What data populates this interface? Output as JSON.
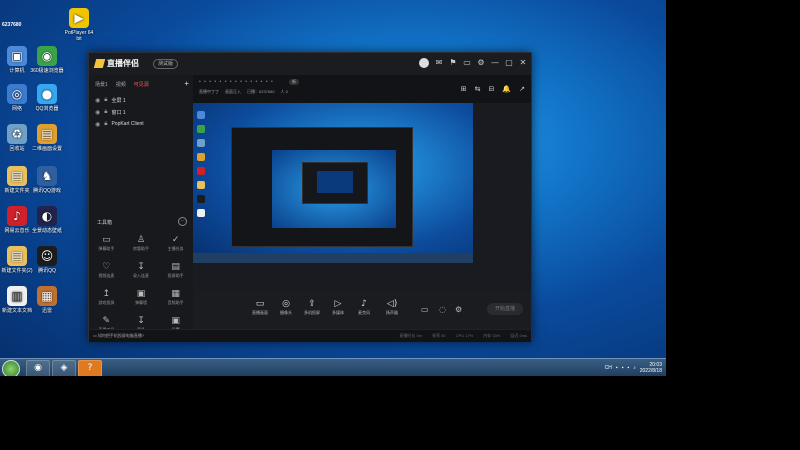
{
  "desktop": {
    "top_left_label": "6237680",
    "icons": [
      {
        "id": "potplayer",
        "label": "PotPlayer 64 bit",
        "glyph": "▶",
        "color": "#f0c400"
      },
      {
        "id": "computer",
        "label": "计算机",
        "glyph": "▣",
        "color": "#4a8ad8"
      },
      {
        "id": "browser360",
        "label": "360极速浏览器",
        "glyph": "◉",
        "color": "#3aa34a"
      },
      {
        "id": "network",
        "label": "网络",
        "glyph": "◎",
        "color": "#3b7bd0"
      },
      {
        "id": "qqbrowser",
        "label": "QQ浏览器",
        "glyph": "●",
        "color": "#37a7f0"
      },
      {
        "id": "recycle",
        "label": "回收站",
        "glyph": "♻",
        "color": "#6fa0c8"
      },
      {
        "id": "folder1",
        "label": "二维画面设置",
        "glyph": "▤",
        "color": "#e0a030"
      },
      {
        "id": "folder2",
        "label": "新建文件夹",
        "glyph": "▤",
        "color": "#e8c060"
      },
      {
        "id": "qqgame",
        "label": "腾讯QQ游戏",
        "glyph": "♞",
        "color": "#2f5fa0"
      },
      {
        "id": "netease",
        "label": "网易云音乐",
        "glyph": "♪",
        "color": "#d0202a"
      },
      {
        "id": "wallpaper",
        "label": "全景动态壁纸",
        "glyph": "◐",
        "color": "#22224a"
      },
      {
        "id": "folder3",
        "label": "新建文件夹(2)",
        "glyph": "▤",
        "color": "#e8c060"
      },
      {
        "id": "qq",
        "label": "腾讯QQ",
        "glyph": "☺",
        "color": "#1c1c1c"
      },
      {
        "id": "doc",
        "label": "新建文本文档",
        "glyph": "▥",
        "color": "#f0f0f0"
      },
      {
        "id": "box",
        "label": "迅雷",
        "glyph": "▦",
        "color": "#c07030"
      }
    ]
  },
  "taskbar": {
    "apps": [
      "◉",
      "◈",
      "?"
    ],
    "tray_lang": "CH",
    "time": "20:03",
    "date": "2022/8/18"
  },
  "app": {
    "name": "直播伴侣",
    "version_label": "测试版",
    "title_icons": [
      "✉",
      "⚑",
      "▭",
      "⚙",
      "—",
      "▢",
      "✕"
    ],
    "left_tabs": [
      "场景1",
      "视频",
      "可见源"
    ],
    "active_tab": "可见源",
    "sources": [
      {
        "name": "全屏 1"
      },
      {
        "name": "窗口 1"
      },
      {
        "name": "PopKart Client"
      }
    ],
    "tools_title": "工具箱",
    "tools": [
      {
        "label": "弹幕助手",
        "glyph": "▭"
      },
      {
        "label": "房管助手",
        "glyph": "♙"
      },
      {
        "label": "主播任务",
        "glyph": "✓"
      },
      {
        "label": "视频连麦",
        "glyph": "♡"
      },
      {
        "label": "录入连麦",
        "glyph": "↧"
      },
      {
        "label": "投屏助手",
        "glyph": "▤"
      },
      {
        "label": "游戏投屏",
        "glyph": "↥"
      },
      {
        "label": "弹幕墙",
        "glyph": "▣"
      },
      {
        "label": "音频助手",
        "glyph": "▦"
      },
      {
        "label": "直播工具",
        "glyph": "✎"
      },
      {
        "label": "更多",
        "glyph": "↧"
      },
      {
        "label": "设置",
        "glyph": "▣"
      }
    ],
    "scene_dots": "• • • • • • • • • • • • • • •",
    "scene_tag": "新",
    "scene_info": [
      "直播中丁丁",
      "画面正入",
      "已播：6237680",
      "人 0"
    ],
    "strip_icons": [
      "⊞",
      "⇆",
      "⊟",
      "🔔",
      "↗"
    ],
    "controls": [
      {
        "label": "直播画面",
        "glyph": "▭"
      },
      {
        "label": "摄像头",
        "glyph": "◎"
      },
      {
        "label": "多机投屏",
        "glyph": "⇪"
      },
      {
        "label": "多媒体",
        "glyph": "▷"
      },
      {
        "label": "麦克风",
        "glyph": "♪"
      },
      {
        "label": "扬声器",
        "glyph": "◁)"
      }
    ],
    "live_button": "开始直播",
    "status_tip": "如何把手机投屏电脑直播?",
    "stats": [
      "直播时长 0m",
      "帧率 60",
      "CPU 17%",
      "内存 33%",
      "延迟 0ms"
    ]
  }
}
